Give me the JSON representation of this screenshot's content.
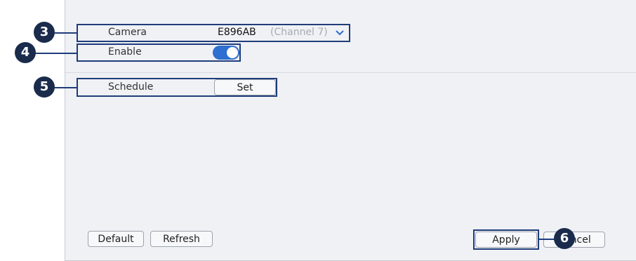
{
  "form": {
    "camera_label": "Camera",
    "camera_value": "E896AB",
    "camera_channel": "(Channel 7)",
    "enable_label": "Enable",
    "enable_on": true,
    "schedule_label": "Schedule",
    "set_label": "Set"
  },
  "buttons": {
    "default_label": "Default",
    "refresh_label": "Refresh",
    "apply_label": "Apply",
    "cancel_label": "Cancel"
  },
  "callouts": [
    "3",
    "4",
    "5",
    "6"
  ],
  "colors": {
    "accent": "#2e6fd0",
    "callout": "#1a2b4c",
    "highlight": "#1f3d7a",
    "panel": "#f0f1f5"
  }
}
